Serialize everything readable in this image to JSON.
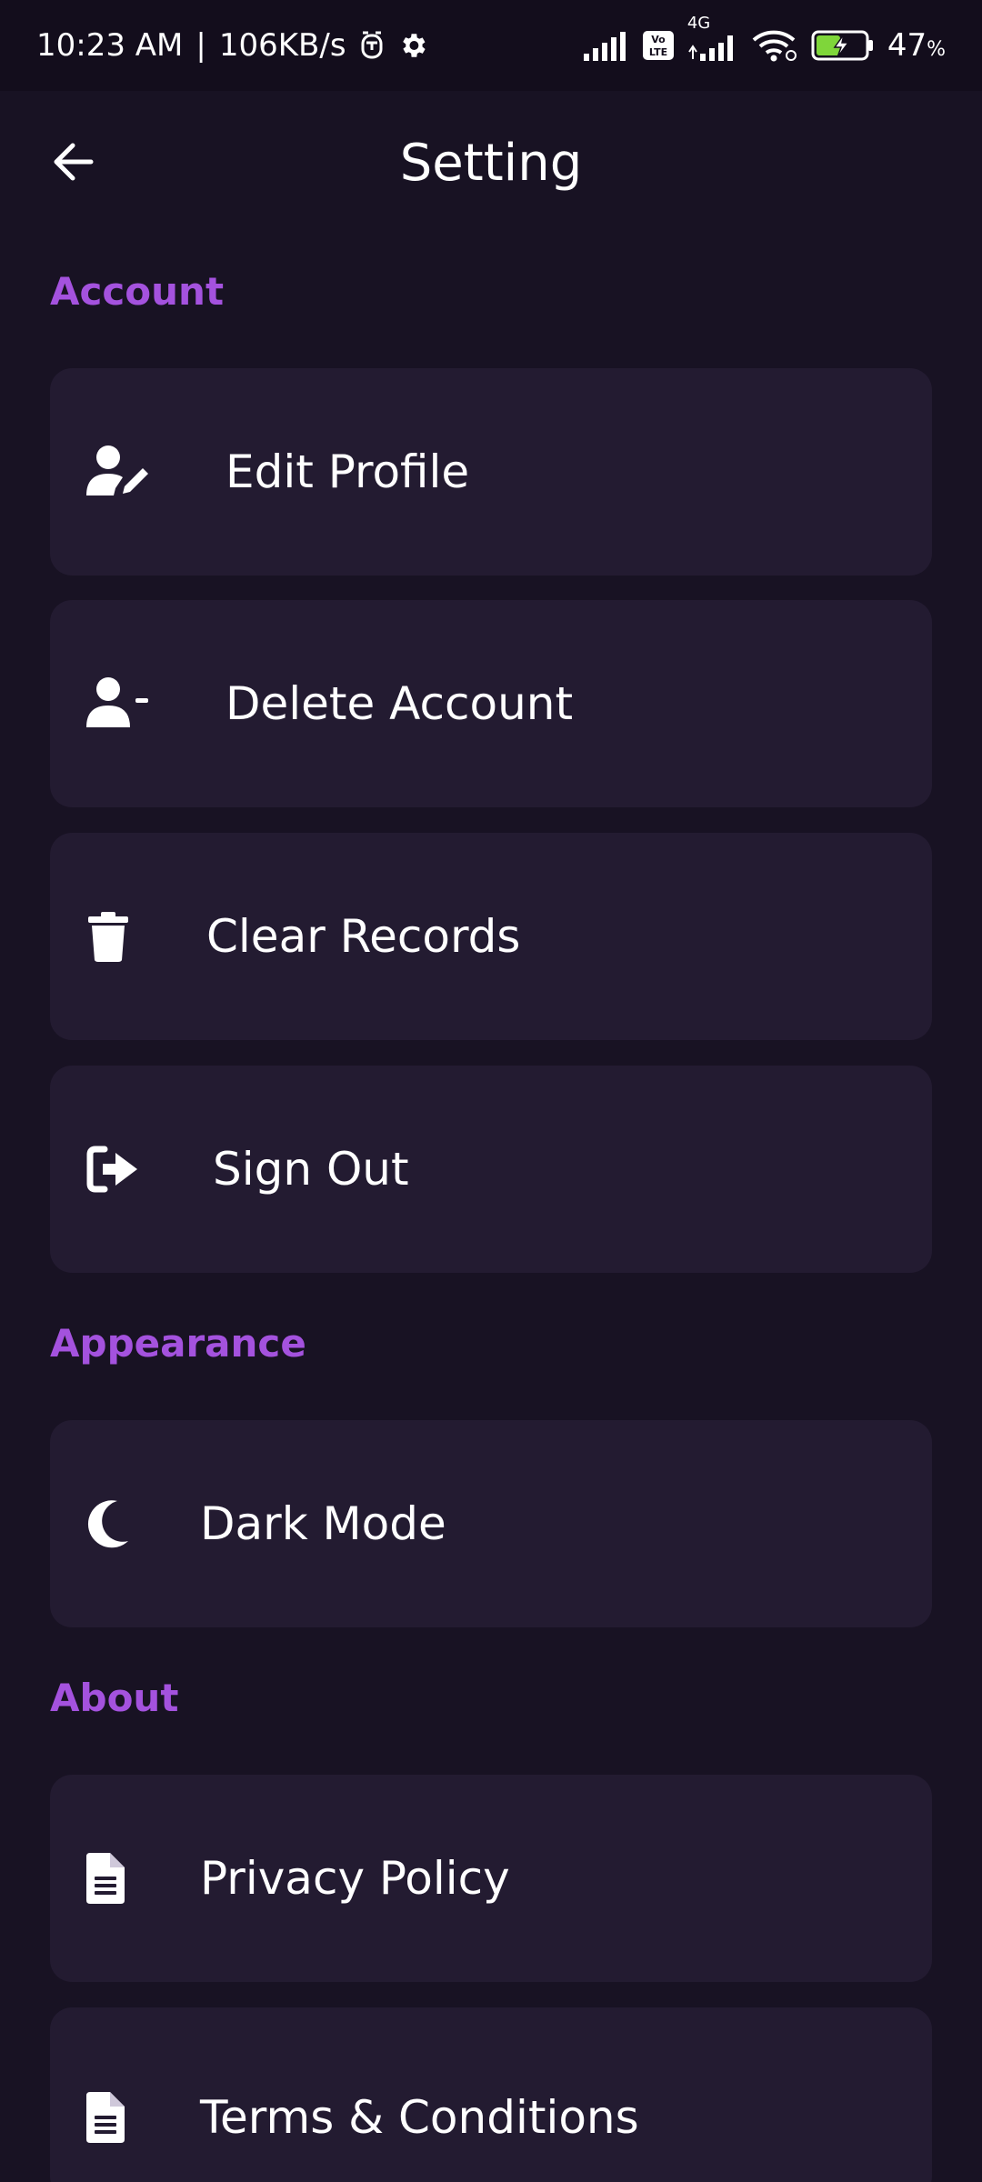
{
  "status_bar": {
    "time": "10:23 AM",
    "separator": "|",
    "speed": "106KB/s",
    "network_type": "4G",
    "battery_percent": "47",
    "battery_suffix": "%",
    "icons": [
      "alarm-icon",
      "gear-icon",
      "signal-icon",
      "volte-icon",
      "signal-4g-icon",
      "wifi-icon",
      "battery-charging-icon"
    ]
  },
  "header": {
    "title": "Setting",
    "back_icon": "arrow-left-icon"
  },
  "sections": {
    "account": {
      "label": "Account",
      "items": [
        {
          "label": "Edit Profile",
          "icon": "user-edit-icon"
        },
        {
          "label": "Delete Account",
          "icon": "user-minus-icon"
        },
        {
          "label": "Clear Records",
          "icon": "trash-icon"
        },
        {
          "label": "Sign Out",
          "icon": "sign-out-icon"
        }
      ]
    },
    "appearance": {
      "label": "Appearance",
      "items": [
        {
          "label": "Dark Mode",
          "icon": "moon-icon"
        }
      ]
    },
    "about": {
      "label": "About",
      "items": [
        {
          "label": "Privacy Policy",
          "icon": "document-icon"
        },
        {
          "label": "Terms & Conditions",
          "icon": "document-icon"
        }
      ]
    }
  },
  "colors": {
    "background": "#181223",
    "status_bar": "#130d1c",
    "card": "#231b31",
    "accent": "#a452de",
    "text": "#ffffff"
  }
}
